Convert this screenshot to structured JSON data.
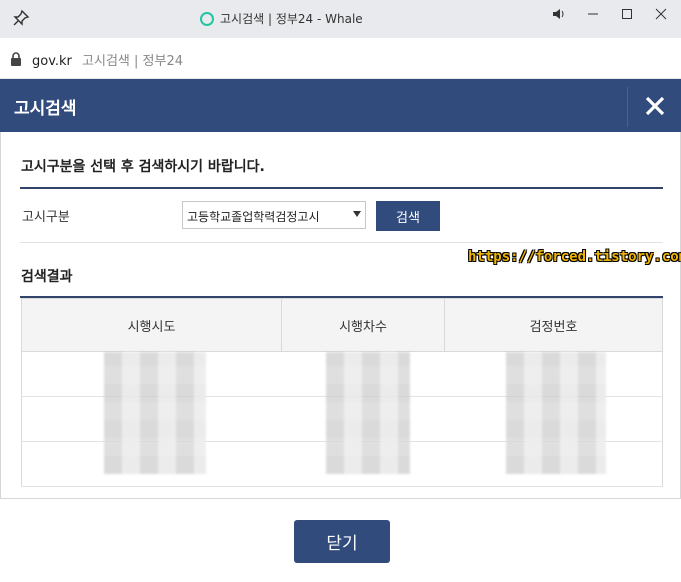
{
  "window": {
    "title": "고시검색 | 정부24 - Whale"
  },
  "address": {
    "domain": "gov.kr",
    "page_title": "고시검색 | 정부24"
  },
  "modal": {
    "title": "고시검색",
    "instruction": "고시구분을 선택 후 검색하시기 바랍니다.",
    "kind_label": "고시구분",
    "kind_selected": "고등학교졸업학력검정고시",
    "search_button": "검색",
    "results_title": "검색결과",
    "columns": [
      "시행시도",
      "시행차수",
      "검정번호"
    ],
    "close_button": "닫기"
  },
  "watermark": "https://forced.tistory.com",
  "colors": {
    "header_bg": "#314b7c",
    "button_bg": "#314b7c",
    "rule_dark": "#33446a"
  }
}
